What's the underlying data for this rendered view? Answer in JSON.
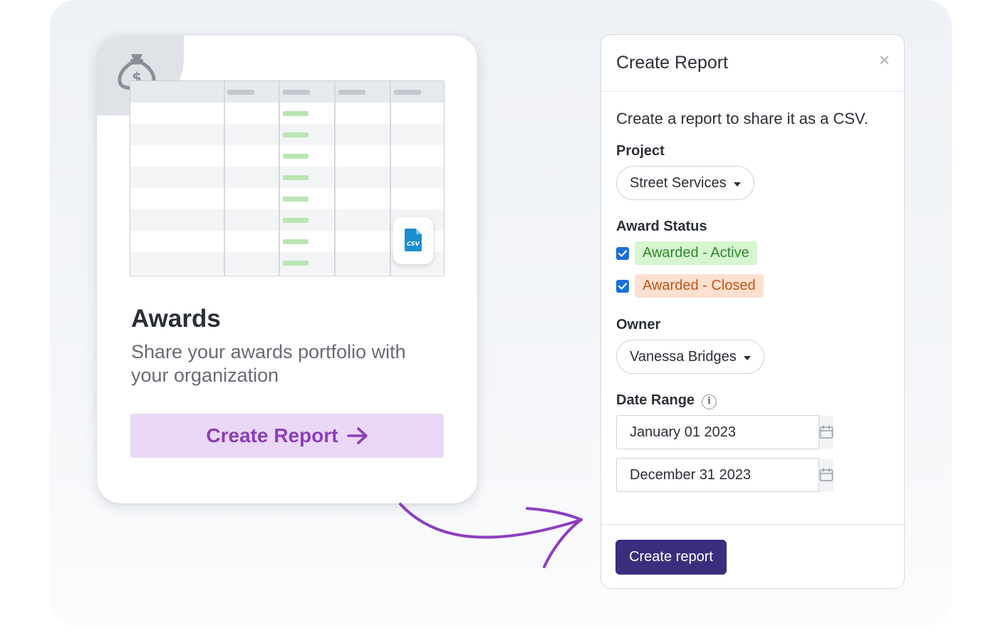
{
  "card": {
    "icon": "money-bag-icon",
    "file_icon": "csv-file-icon",
    "file_label": "CSV",
    "title": "Awards",
    "subtitle": "Share your awards portfolio with your organization",
    "button_label": "Create Report"
  },
  "dialog": {
    "title": "Create Report",
    "close_symbol": "×",
    "description": "Create a report to share it as a CSV.",
    "project": {
      "label": "Project",
      "value": "Street Services"
    },
    "award_status": {
      "label": "Award Status",
      "options": [
        {
          "label": "Awarded - Active",
          "checked": true
        },
        {
          "label": "Awarded - Closed",
          "checked": true
        }
      ]
    },
    "owner": {
      "label": "Owner",
      "value": "Vanessa Bridges"
    },
    "date_range": {
      "label": "Date Range",
      "info_symbol": "i",
      "start": "January 01 2023",
      "end": "December 31 2023"
    },
    "submit_label": "Create report"
  },
  "colors": {
    "primary": "#3a2f7e",
    "accent_purple": "#8a3fb8",
    "active_bg": "#d6f5d0",
    "closed_bg": "#fde0cf",
    "checkbox": "#1a6fd9"
  }
}
